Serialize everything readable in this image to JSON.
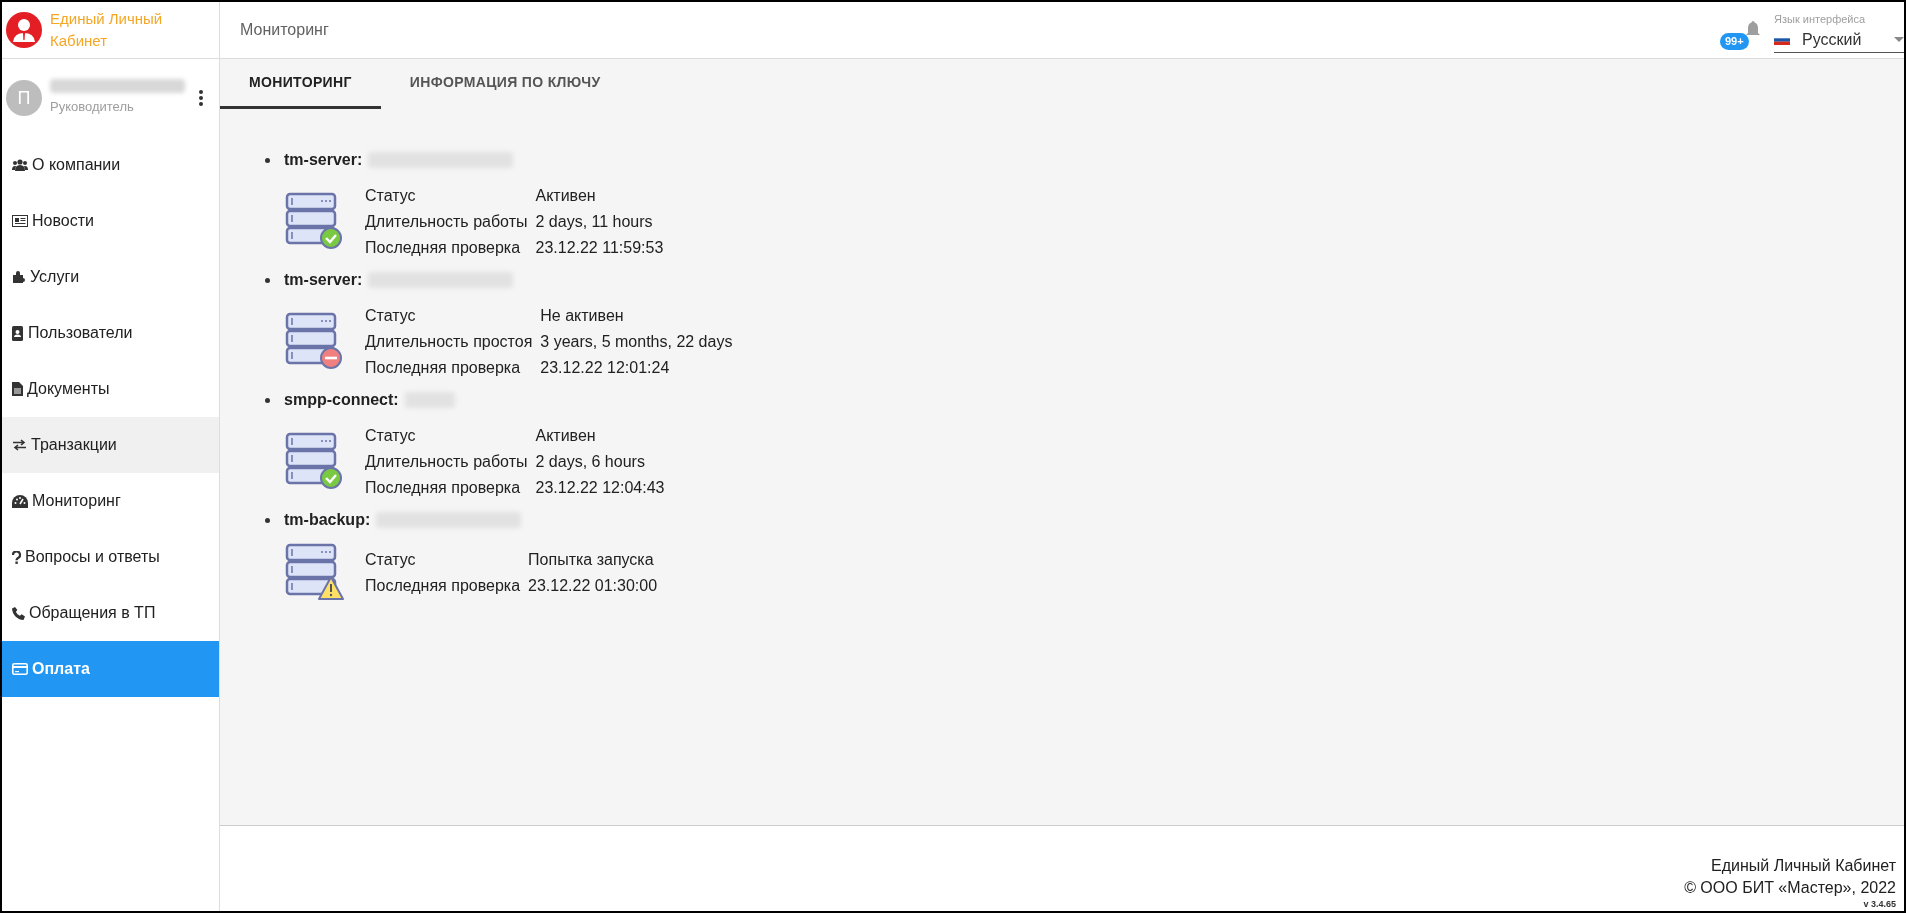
{
  "app": {
    "title": "Единый Личный Кабинет"
  },
  "header": {
    "page_title": "Мониторинг",
    "notifications_badge": "99+",
    "language": {
      "label": "Язык интерфейса",
      "value": "Русский"
    }
  },
  "profile": {
    "avatar_letter": "П",
    "role": "Руководитель"
  },
  "sidebar": {
    "items": [
      {
        "label": "О компании",
        "selected": false,
        "hovered": false
      },
      {
        "label": "Новости",
        "selected": false,
        "hovered": false
      },
      {
        "label": "Услуги",
        "selected": false,
        "hovered": false
      },
      {
        "label": "Пользователи",
        "selected": false,
        "hovered": false
      },
      {
        "label": "Документы",
        "selected": false,
        "hovered": false
      },
      {
        "label": "Транзакции",
        "selected": false,
        "hovered": true
      },
      {
        "label": "Мониторинг",
        "selected": false,
        "hovered": false
      },
      {
        "label": "Вопросы и ответы",
        "selected": false,
        "hovered": false
      },
      {
        "label": "Обращения в ТП",
        "selected": false,
        "hovered": false
      },
      {
        "label": "Оплата",
        "selected": true,
        "hovered": false
      }
    ]
  },
  "tabs": [
    {
      "label": "МОНИТОРИНГ",
      "selected": true
    },
    {
      "label": "ИНФОРМАЦИЯ ПО КЛЮЧУ",
      "selected": false
    }
  ],
  "servers": [
    {
      "name": "tm-server:",
      "kind": "ok",
      "rows": [
        {
          "label": "Статус",
          "value": "Активен"
        },
        {
          "label": "Длительность работы",
          "value": "2 days, 11 hours"
        },
        {
          "label": "Последняя проверка",
          "value": "23.12.22 11:59:53"
        }
      ]
    },
    {
      "name": "tm-server:",
      "kind": "down",
      "rows": [
        {
          "label": "Статус",
          "value": "Не активен"
        },
        {
          "label": "Длительность простоя",
          "value": "3 years, 5 months, 22 days"
        },
        {
          "label": "Последняя проверка",
          "value": "23.12.22 12:01:24"
        }
      ]
    },
    {
      "name": "smpp-connect:",
      "kind": "ok",
      "rows": [
        {
          "label": "Статус",
          "value": "Активен"
        },
        {
          "label": "Длительность работы",
          "value": "2 days, 6 hours"
        },
        {
          "label": "Последняя проверка",
          "value": "23.12.22 12:04:43"
        }
      ]
    },
    {
      "name": "tm-backup:",
      "kind": "warning",
      "rows": [
        {
          "label": "Статус",
          "value": "Попытка запуска"
        },
        {
          "label": "Последняя проверка",
          "value": "23.12.22 01:30:00"
        }
      ]
    }
  ],
  "footer": {
    "line_1": "Единый Личный Кабинет",
    "line_2": "© ООО БИТ «Мастер», 2022",
    "version": "v 3.4.65"
  }
}
